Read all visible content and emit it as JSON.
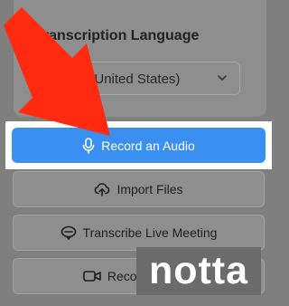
{
  "transcription": {
    "title": "Transcription Language",
    "selected_language": "English (United States)"
  },
  "buttons": {
    "record_audio": "Record an Audio",
    "import_files": "Import Files",
    "transcribe_live": "Transcribe Live Meeting",
    "record_video": "Record a Video"
  },
  "icons": {
    "language_select": "chevron-down-icon",
    "record_audio": "microphone-icon",
    "import_files": "cloud-upload-icon",
    "transcribe_live": "meeting-icon",
    "record_video": "video-camera-icon",
    "annotation": "arrow-icon"
  },
  "watermark": {
    "text": "notta"
  },
  "colors": {
    "primary_button": "#3b8ff0",
    "annotation_arrow": "#ff2a0f",
    "highlight_frame": "#ffffff",
    "overlay": "#7f7f7f"
  }
}
